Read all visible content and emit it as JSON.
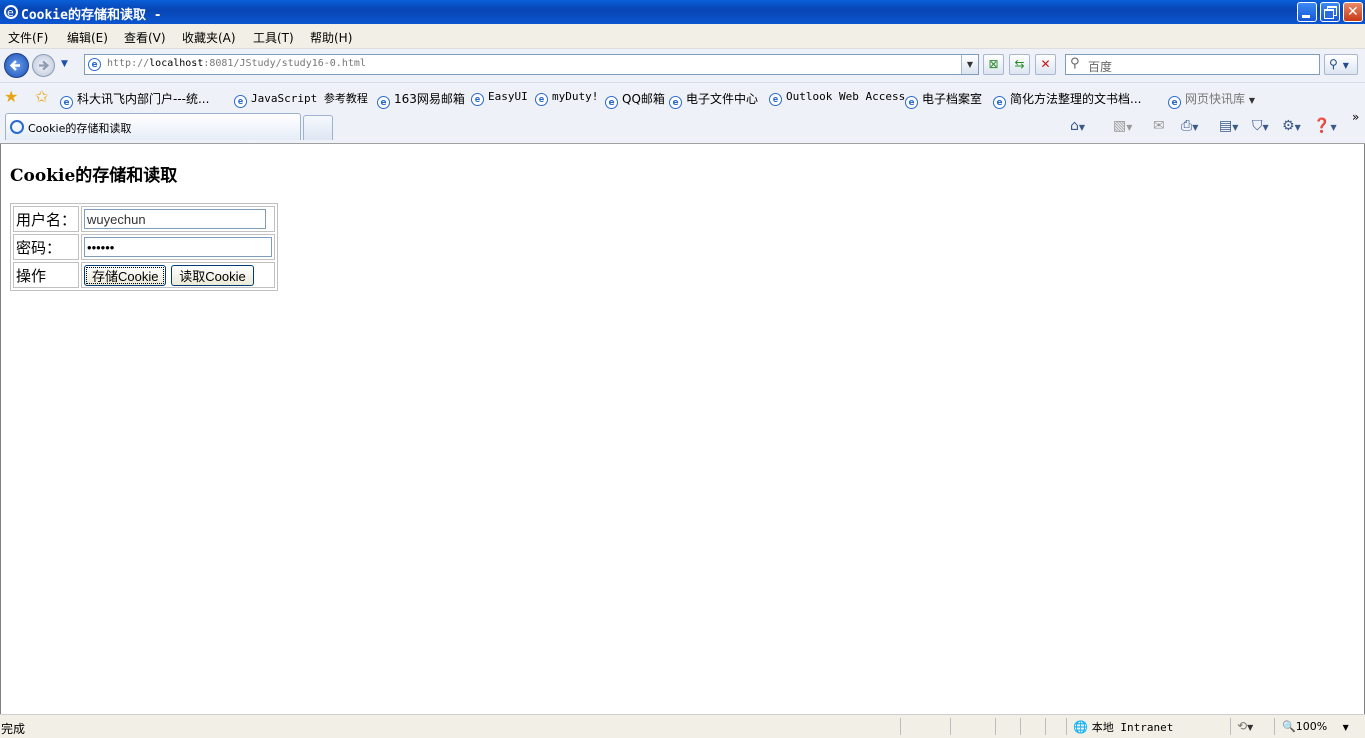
{
  "window": {
    "title": "Cookie的存储和读取 -"
  },
  "menu": [
    "文件(F)",
    "编辑(E)",
    "查看(V)",
    "收藏夹(A)",
    "工具(T)",
    "帮助(H)"
  ],
  "address": {
    "prefix": "http://",
    "host": "localhost",
    "rest": ":8081/JStudy/study16-0.html"
  },
  "search": {
    "placeholder": "百度"
  },
  "favorites": [
    "科大讯飞内部门户---统...",
    "JavaScript 参考教程",
    "163网易邮箱",
    "EasyUI",
    "myDuty!",
    "QQ邮箱",
    "电子文件中心",
    "Outlook Web Access",
    "电子档案室",
    "简化方法整理的文书档...",
    "网页快讯库"
  ],
  "tab": {
    "label": "Cookie的存储和读取"
  },
  "page": {
    "heading": "Cookie的存储和读取",
    "username_label": "用户名：",
    "username_value": "wuyechun",
    "password_label": "密码：",
    "password_value": "wuyech",
    "action_label": "操作",
    "store_button": "存储Cookie",
    "read_button": "读取Cookie"
  },
  "status": {
    "text": "完成",
    "zone": "本地 Intranet",
    "zoom": "100%"
  }
}
